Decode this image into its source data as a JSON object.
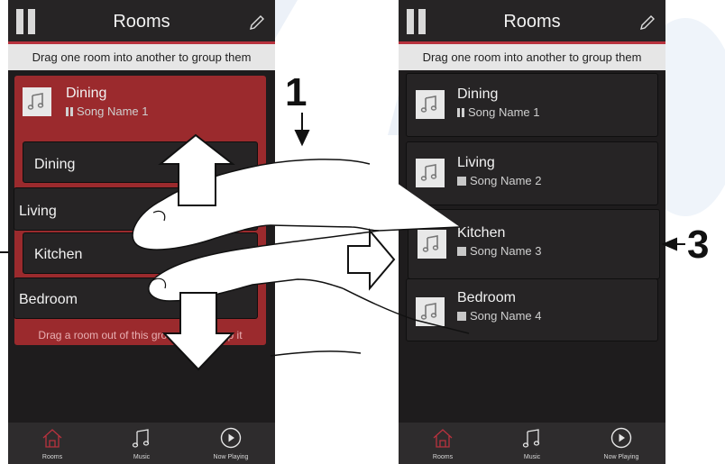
{
  "left_screen": {
    "title": "Rooms",
    "hint": "Drag one room into another to group them",
    "group": {
      "name": "Dining",
      "song": "Song Name 1"
    },
    "group_members": [
      "Dining",
      "Living",
      "Kitchen",
      "Bedroom"
    ],
    "drag_out_hint": "Drag a room out of this group to ungroup it",
    "tabs": [
      {
        "label": "Rooms",
        "icon": "house-icon",
        "active": true
      },
      {
        "label": "Music",
        "icon": "music-note-icon",
        "active": false
      },
      {
        "label": "Now Playing",
        "icon": "play-circle-icon",
        "active": false
      }
    ]
  },
  "right_screen": {
    "title": "Rooms",
    "hint": "Drag one room into another to group them",
    "rooms": [
      {
        "name": "Dining",
        "song": "Song Name 1",
        "state": "pause"
      },
      {
        "name": "Living",
        "song": "Song Name 2",
        "state": "stop"
      },
      {
        "name": "Kitchen",
        "song": "Song Name 3",
        "state": "stop"
      },
      {
        "name": "Bedroom",
        "song": "Song Name 4",
        "state": "stop"
      }
    ],
    "tabs": [
      {
        "label": "Rooms",
        "icon": "house-icon",
        "active": true
      },
      {
        "label": "Music",
        "icon": "music-note-icon",
        "active": false
      },
      {
        "label": "Now Playing",
        "icon": "play-circle-icon",
        "active": false
      }
    ]
  },
  "steps": {
    "step1": "1",
    "step3": "3"
  },
  "colors": {
    "accent": "#b8323e",
    "group_bg": "#9b2a2d",
    "screen_bg": "#1e1c1d"
  }
}
